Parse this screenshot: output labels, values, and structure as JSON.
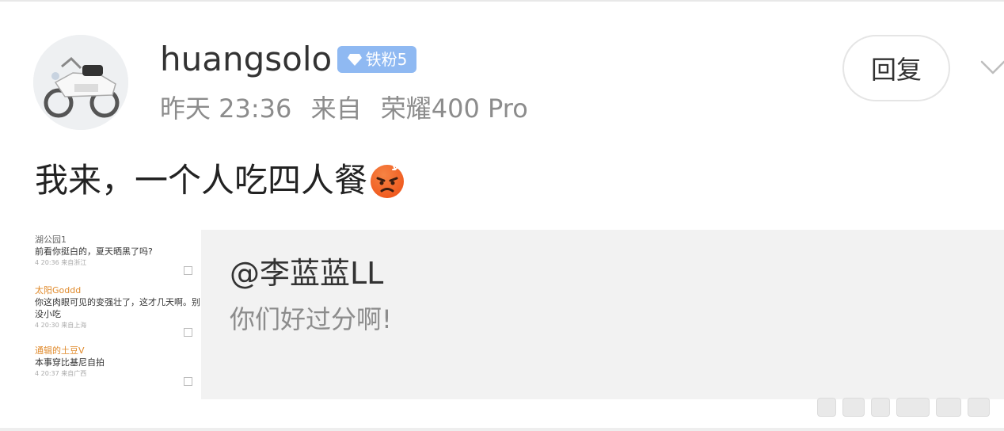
{
  "post": {
    "username": "huangsolo",
    "badge_label": "铁粉5",
    "time": "昨天 23:36",
    "from_prefix": "来自",
    "device": "荣耀400 Pro",
    "reply_label": "回复",
    "text": "我来，一个人吃四人餐",
    "emoji_icon": "angry-face-icon"
  },
  "quote": {
    "mention": "@李蓝蓝LL",
    "text": "你们好过分啊!",
    "thumbnail_comments": [
      {
        "name": "湖公园1",
        "text": "前看你挺白的，夏天晒黑了吗?",
        "meta": "4 20:36 来自浙江"
      },
      {
        "name": "太阳Goddd",
        "text": "你这肉眼可见的变强壮了，这才几天啊。别",
        "text2": "没小吃",
        "meta": "4 20:30 来自上海"
      },
      {
        "name": "通辑的土豆V",
        "text": "本事穿比基尼自拍",
        "meta": "4 20:37 来自广西"
      }
    ]
  },
  "colors": {
    "badge_bg": "#8fb9f2",
    "meta_gray": "#8c8c8c",
    "quote_bg": "#f2f2f2"
  }
}
